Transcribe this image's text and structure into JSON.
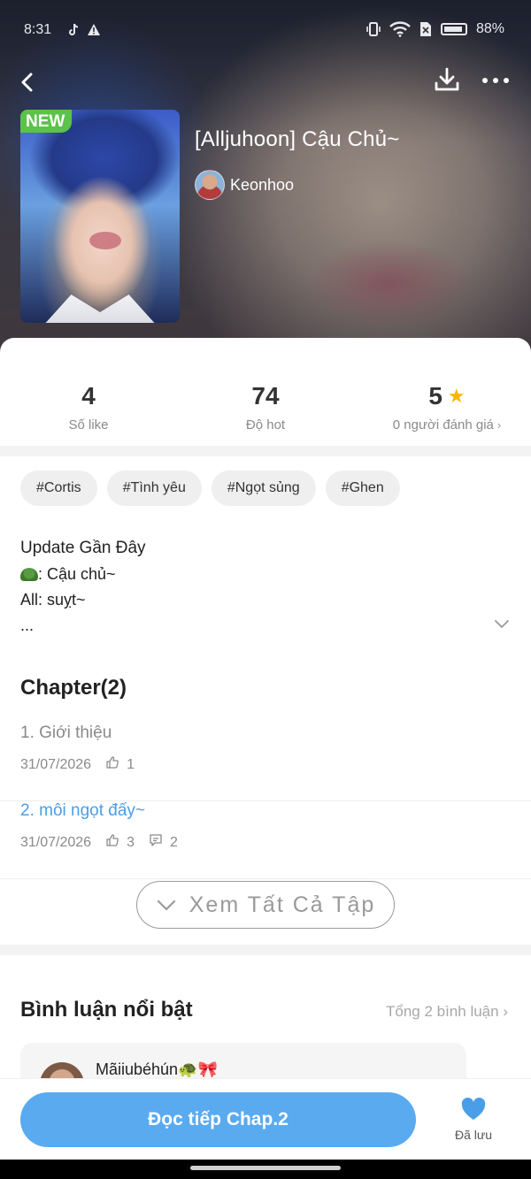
{
  "status_bar": {
    "time": "8:31",
    "battery": "88%",
    "left_icons": [
      "tiktok-icon",
      "warning-icon"
    ],
    "right_icons": [
      "vibrate-icon",
      "wifi-icon",
      "sim-off-icon",
      "battery-icon"
    ]
  },
  "header": {
    "badge": "NEW",
    "title": "[Alljuhoon] Cậu Chủ~",
    "author": "Keonhoo"
  },
  "stats": [
    {
      "value": "4",
      "label": "Số like"
    },
    {
      "value": "74",
      "label": "Độ hot"
    },
    {
      "value": "5",
      "label": "0 người đánh giá"
    }
  ],
  "tags": [
    "#Cortis",
    "#Tình yêu",
    "#Ngọt sủng",
    "#Ghen"
  ],
  "update": {
    "title": "Update Gần Đây",
    "line1": ": Cậu chủ~",
    "line2": "All: suỵt~",
    "line3": "..."
  },
  "chapters": {
    "heading": "Chapter(2)",
    "items": [
      {
        "title": "1. Giới thiệu",
        "date": "31/07/2026",
        "likes": "1",
        "comments": ""
      },
      {
        "title": "2. môi ngọt đấy~",
        "date": "31/07/2026",
        "likes": "3",
        "comments": "2"
      }
    ],
    "see_all": "Xem Tất Cả Tập"
  },
  "comments": {
    "heading": "Bình luận nổi bật",
    "total": "Tổng 2 bình luận",
    "first_user": "Mãiiubéhún🐢🎀"
  },
  "bottom": {
    "read_button": "Đọc tiếp Chap.2",
    "saved_label": "Đã lưu"
  },
  "colors": {
    "accent": "#5aaaf0",
    "chapter_link": "#4a9ee8",
    "new_badge": "#5bc24a",
    "star": "#f7b500"
  }
}
